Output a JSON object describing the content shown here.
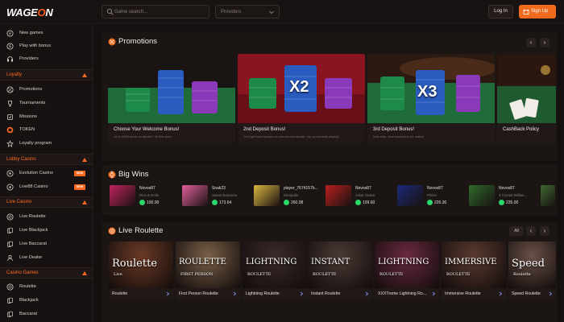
{
  "header": {
    "logo_main": "WAGE",
    "logo_accent": "O",
    "logo_end": "N",
    "search_placeholder": "Game search...",
    "providers_label": "Providers",
    "login_label": "Log In",
    "signup_label": "Sign Up"
  },
  "sidebar": {
    "top_items": [
      {
        "label": "New games",
        "icon": "new-games-icon"
      },
      {
        "label": "Play with bonus",
        "icon": "bonus-icon"
      },
      {
        "label": "Providers",
        "icon": "providers-icon"
      }
    ],
    "loyalty": {
      "title": "Loyalty",
      "items": [
        {
          "label": "Promotions",
          "icon": "promotions-icon"
        },
        {
          "label": "Tournaments",
          "icon": "tournaments-icon"
        },
        {
          "label": "Missions",
          "icon": "missions-icon"
        },
        {
          "label": "TOKEN",
          "icon": "token-icon"
        },
        {
          "label": "Loyalty program",
          "icon": "loyalty-icon"
        }
      ]
    },
    "lobby": {
      "title": "Lobby Casino",
      "items": [
        {
          "label": "Evolution Casino",
          "badge": "NEW"
        },
        {
          "label": "Live88 Casino",
          "badge": "NEW"
        }
      ]
    },
    "live": {
      "title": "Live Casino",
      "items": [
        {
          "label": "Live Roulette"
        },
        {
          "label": "Live Blackjack"
        },
        {
          "label": "Live Baccarat"
        },
        {
          "label": "Live Dealer"
        }
      ]
    },
    "casino": {
      "title": "Casino Games",
      "items": [
        {
          "label": "Roulette"
        },
        {
          "label": "Blackjack"
        },
        {
          "label": "Baccarat"
        }
      ]
    }
  },
  "promotions": {
    "title": "Promotions",
    "cards": [
      {
        "title": "Choose Your Welcome Bonus!",
        "desc": "Up to 200% bonus on deposit + 3k free spins",
        "overlay": ""
      },
      {
        "title": "2nd Deposit Bonus!",
        "desc": "You'll get more bonuses on your second deposit - top up and keep playing!",
        "overlay": "X2"
      },
      {
        "title": "3rd Deposit Bonus!",
        "desc": "More bets, more bonuses in our casino!",
        "overlay": "X3"
      },
      {
        "title": "CashBack Policy",
        "desc": "",
        "overlay": ""
      }
    ]
  },
  "big_wins": {
    "title": "Big Wins",
    "items": [
      {
        "user": "Novos87",
        "game": "Dice & Dolls",
        "amount": "100.00",
        "color": "#c0245e"
      },
      {
        "user": "Snak23",
        "game": "Sweet Bonanza",
        "amount": "173.64",
        "color": "#e0609a"
      },
      {
        "user": "player_7674157b...",
        "game": "Dinopolis",
        "amount": "260.08",
        "color": "#d9b640"
      },
      {
        "user": "Novos87",
        "game": "Joker Stoker",
        "amount": "109.60",
        "color": "#b8201c"
      },
      {
        "user": "Novos87",
        "game": "Plinko",
        "amount": "226.30",
        "color": "#1a2b78"
      },
      {
        "user": "Novos87",
        "game": "3 Crystal Willian...",
        "amount": "235.00",
        "color": "#2f6b2a"
      },
      {
        "user": "Nov",
        "game": "",
        "amount": "",
        "color": "#3f6a30"
      }
    ]
  },
  "live_roulette": {
    "title": "Live Roulette",
    "all_label": "All",
    "games": [
      {
        "name": "Roulette",
        "overlay": "Roulette",
        "sub": "Live",
        "color": "#6b3a26"
      },
      {
        "name": "First Person Roulette",
        "overlay": "ROULETTE",
        "sub": "FIRST PERSON",
        "color": "#7a6048"
      },
      {
        "name": "Lightning Roulette",
        "overlay": "LIGHTNING",
        "sub": "ROULETTE",
        "color": "#3a2a2a"
      },
      {
        "name": "Instant Roulette",
        "overlay": "INSTANT",
        "sub": "ROULETTE",
        "color": "#4a3a36"
      },
      {
        "name": "XXXTreme Lightning Ro...",
        "overlay": "LIGHTNING",
        "sub": "ROULETTE",
        "color": "#6a2a40"
      },
      {
        "name": "Immersive Roulette",
        "overlay": "IMMERSIVE",
        "sub": "ROULETTE",
        "color": "#5a3a30"
      },
      {
        "name": "Speed Roulette",
        "overlay": "Speed",
        "sub": "Roulette",
        "color": "#6a5048"
      }
    ]
  },
  "colors": {
    "accent": "#f06a1d",
    "bg": "#141010",
    "panel": "#1b1514"
  }
}
